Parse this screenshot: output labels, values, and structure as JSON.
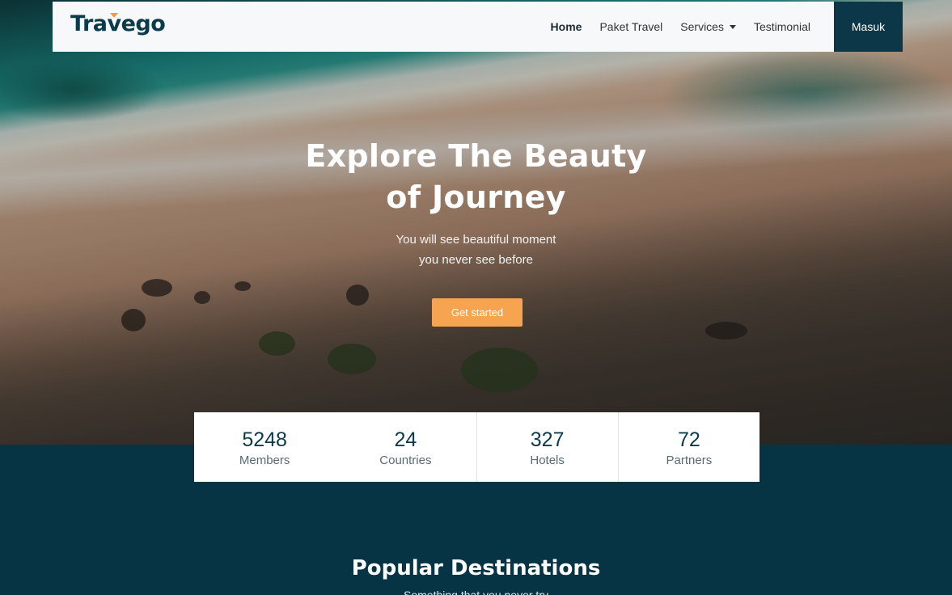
{
  "navbar": {
    "brand": "Travego",
    "links": [
      {
        "label": "Home",
        "active": true
      },
      {
        "label": "Paket Travel"
      },
      {
        "label": "Services",
        "dropdown": true
      },
      {
        "label": "Testimonial"
      }
    ],
    "login_label": "Masuk"
  },
  "hero": {
    "title": "Explore The Beauty\nof Journey",
    "subtitle": "You will see beautiful moment\nyou never see before",
    "cta_label": "Get started"
  },
  "stats": [
    {
      "value": "5248",
      "label": "Members"
    },
    {
      "value": "24",
      "label": "Countries"
    },
    {
      "value": "327",
      "label": "Hotels"
    },
    {
      "value": "72",
      "label": "Partners"
    }
  ],
  "section": {
    "title": "Popular Destinations",
    "subtitle": "Something that you never try"
  },
  "colors": {
    "brand": "#0b3a4a",
    "accent": "#f7a450",
    "background": "#063445"
  }
}
